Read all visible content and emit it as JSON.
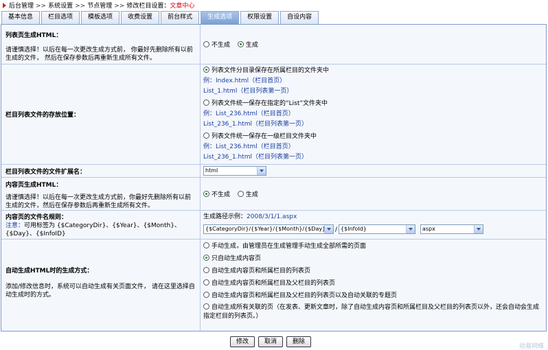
{
  "breadcrumb": {
    "items": [
      "后台管理",
      "系统设置",
      "节点管理",
      "修改栏目设置："
    ],
    "current": "文章中心"
  },
  "tabs": [
    "基本信息",
    "栏目选项",
    "模板选项",
    "收费设置",
    "前台样式",
    "生成选项",
    "权限设置",
    "自设内容"
  ],
  "active_tab": "生成选项",
  "list_html": {
    "label": "列表页生成HTML：",
    "desc": "请谨慎选择！以后在每一次更改生成方式前， 你最好先删除所有以前生成的文件， 然后在保存参数后再重新生成所有文件。",
    "options": [
      "不生成",
      "生成"
    ],
    "selected": "生成"
  },
  "storage": {
    "label": "栏目列表文件的存放位置：",
    "options": [
      {
        "text": "列表文件分目录保存在所属栏目的文件夹中",
        "ex1": "例：Index.html（栏目首页）",
        "ex2": "List_1.html（栏目列表第一页）"
      },
      {
        "text": "列表文件统一保存在指定的“List”文件夹中",
        "ex1": "例：List_236.html（栏目首页）",
        "ex2": "List_236_1.html（栏目列表第一页）"
      },
      {
        "text": "列表文件统一保存在一级栏目文件夹中",
        "ex1": "例：List_236.html（栏目首页）",
        "ex2": "List_236_1.html（栏目列表第一页）"
      }
    ],
    "selected_index": 0
  },
  "ext": {
    "label": "栏目列表文件的文件扩展名：",
    "value": "html"
  },
  "content_html": {
    "label": "内容页生成HTML：",
    "desc": "请谨慎选择！以后在每一次更改生成方式前，你最好先删除所有以前生成的文件，然后在保存参数后再重新生成所有文件。",
    "options": [
      "不生成",
      "生成"
    ],
    "selected": "不生成"
  },
  "filename_rule": {
    "label": "内容页的文件名规则：",
    "note_label": "注意：",
    "note": "可用标签为 {$CategoryDir}、{$Year}、{$Month}、{$Day}、{$InfoID}",
    "example_label": "生成路径示例：",
    "example": "2008/3/1/1.aspx",
    "select1": "{$CategoryDir}/{$Year}/{$Month}/{$Day}",
    "slash": "/",
    "select2": "{$InfoId}",
    "select3": "aspx"
  },
  "auto_gen": {
    "label": "自动生成HTML时的生成方式：",
    "desc": "添加/修改信息时，系统可以自动生成有关页面文件， 请在这里选择自动生成时的方式。",
    "options": [
      "手动生成，由管理员在生成管理手动生成全部所需的页面",
      "只自动生成内容页",
      "自动生成内容页和所属栏目的列表页",
      "自动生成内容页和所属栏目及父栏目的列表页",
      "自动生成内容页和所属栏目及父栏目的列表页以及自动关联的专题页",
      "自动生成所有关联的页（在发表、更新文章时，除了自动生成内容页和所属栏目及父栏目的列表页以外，还会自动会生成指定栏目的列表页。）"
    ],
    "selected_index": 1
  },
  "buttons": {
    "edit": "修改",
    "cancel": "取消",
    "delete": "删除"
  },
  "watermark": "动易网络"
}
